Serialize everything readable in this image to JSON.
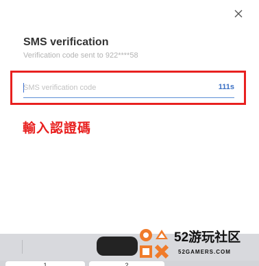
{
  "dialog": {
    "title": "SMS verification",
    "subtitle": "Verification code sent to 922****58",
    "input_placeholder": "SMS verification code",
    "input_value": "",
    "countdown": "111s"
  },
  "annotation": {
    "text": "輸入認證碼",
    "color": "#e8201f"
  },
  "keyboard": {
    "keys": [
      "1",
      "2"
    ]
  },
  "watermark": {
    "logo_text": "52游玩社区",
    "site": "52GAMERS.COM"
  },
  "colors": {
    "accent": "#3a6fc4",
    "highlight": "#e8201f",
    "subtitle": "#b3b3b3"
  },
  "icons": {
    "close": "close-icon"
  }
}
